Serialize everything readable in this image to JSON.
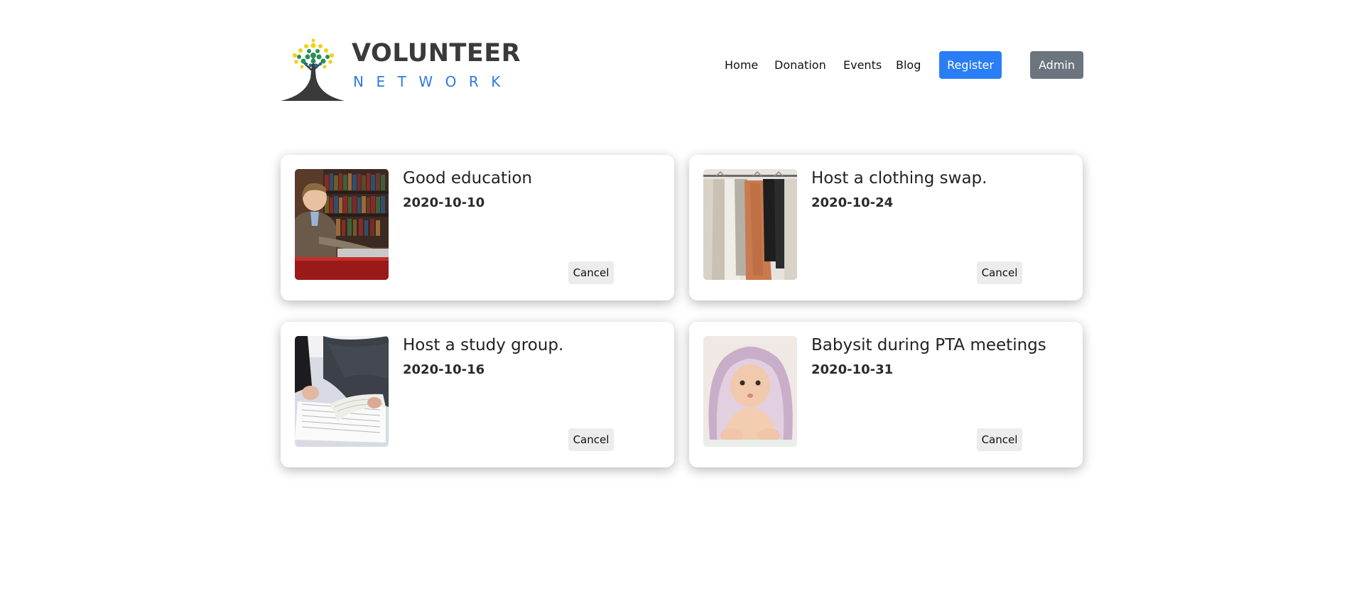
{
  "brand": {
    "title": "VOLUNTEER",
    "subtitle": "NETWORK",
    "colors": {
      "title": "#3a3a3a",
      "subtitle": "#2f7be0",
      "leaf_green": "#2a8f55",
      "leaf_yellow": "#f2d10f",
      "trunk": "#3a3a3a"
    },
    "icon": "tree-logo-icon"
  },
  "nav": {
    "links": [
      "Home",
      "Donation",
      "Events",
      "Blog"
    ],
    "register_label": "Register",
    "admin_label": "Admin",
    "colors": {
      "register": "#2a7ef5",
      "admin": "#6c757d"
    }
  },
  "events": [
    {
      "title": "Good education",
      "date": "2020-10-10",
      "cancel_label": "Cancel",
      "image": "boy-reading-in-library-photo"
    },
    {
      "title": "Host a clothing swap.",
      "date": "2020-10-24",
      "cancel_label": "Cancel",
      "image": "clothes-on-rack-photo"
    },
    {
      "title": "Host a study group.",
      "date": "2020-10-16",
      "cancel_label": "Cancel",
      "image": "open-book-on-desk-photo"
    },
    {
      "title": "Babysit during PTA meetings",
      "date": "2020-10-31",
      "cancel_label": "Cancel",
      "image": "baby-under-blanket-photo"
    }
  ]
}
